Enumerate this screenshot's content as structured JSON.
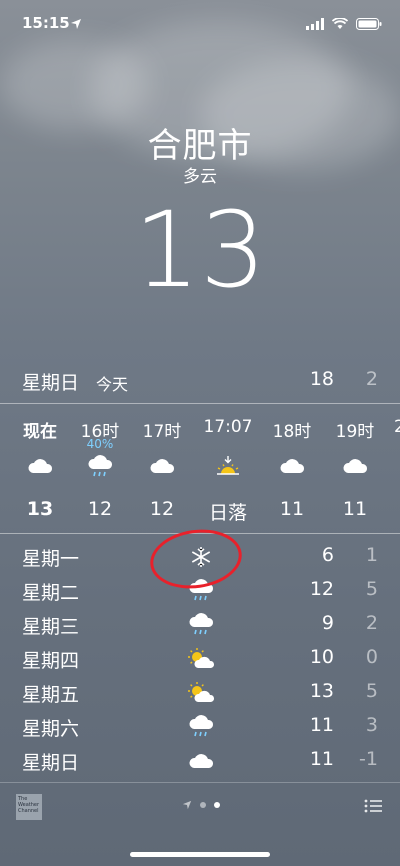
{
  "status_bar": {
    "time": "15:15"
  },
  "location": {
    "city": "合肥市",
    "condition": "多云",
    "temperature": "13"
  },
  "today": {
    "day": "星期日",
    "tag": "今天",
    "high": "18",
    "low": "2"
  },
  "hourly": [
    {
      "label": "现在",
      "pop": "",
      "icon": "cloud-icon",
      "temp": "13"
    },
    {
      "label": "16时",
      "pop": "40%",
      "icon": "rain-icon",
      "temp": "12"
    },
    {
      "label": "17时",
      "pop": "",
      "icon": "cloud-icon",
      "temp": "12"
    },
    {
      "label": "17:07",
      "pop": "",
      "icon": "sunset-icon",
      "temp": "日落"
    },
    {
      "label": "18时",
      "pop": "",
      "icon": "cloud-icon",
      "temp": "11"
    },
    {
      "label": "19时",
      "pop": "",
      "icon": "cloud-icon",
      "temp": "11"
    }
  ],
  "daily": [
    {
      "day": "星期一",
      "icon": "snow-icon",
      "high": "6",
      "low": "1"
    },
    {
      "day": "星期二",
      "icon": "rain-icon",
      "high": "12",
      "low": "5"
    },
    {
      "day": "星期三",
      "icon": "rain-icon",
      "high": "9",
      "low": "2"
    },
    {
      "day": "星期四",
      "icon": "partly-sunny-icon",
      "high": "10",
      "low": "0"
    },
    {
      "day": "星期五",
      "icon": "partly-sunny-icon",
      "high": "13",
      "low": "5"
    },
    {
      "day": "星期六",
      "icon": "rain-icon",
      "high": "11",
      "low": "3"
    },
    {
      "day": "星期日",
      "icon": "cloud-icon",
      "high": "11",
      "low": "-1"
    }
  ],
  "footer": {
    "provider_logo_text": "The Weather Channel"
  },
  "colors": {
    "precipitation": "#7fd0ff",
    "annotation": "#e8212b"
  }
}
